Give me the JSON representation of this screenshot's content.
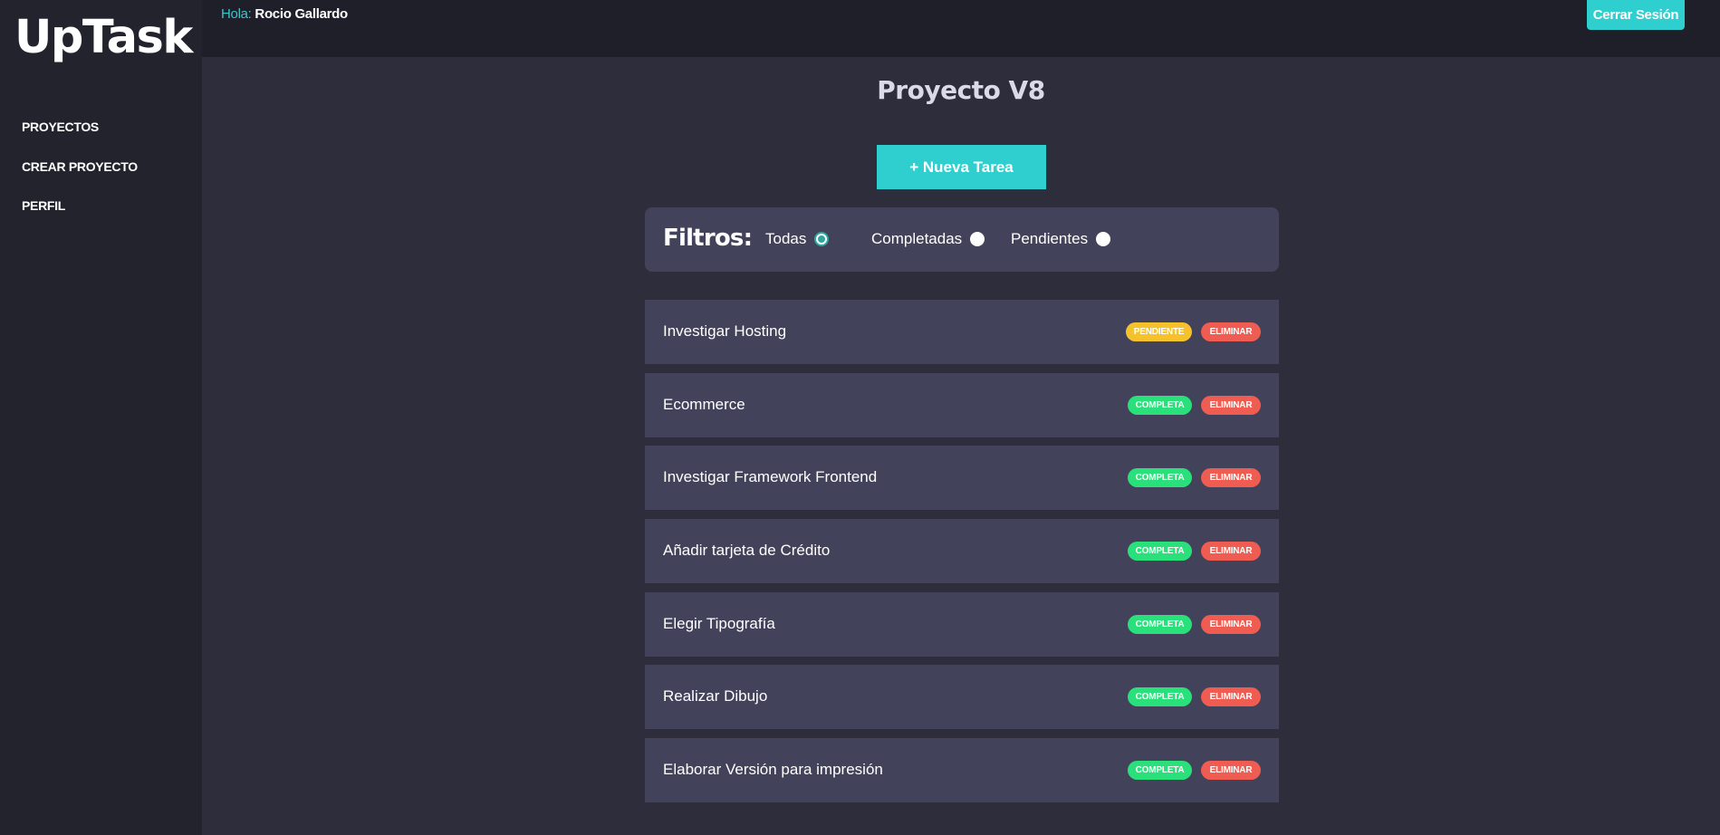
{
  "sidebar": {
    "logo": "UpTask",
    "nav": [
      "PROYECTOS",
      "CREAR PROYECTO",
      "PERFIL"
    ]
  },
  "header": {
    "greeting_label": "Hola:",
    "user_name": "Rocio Gallardo",
    "logout_label": "Cerrar Sesión"
  },
  "main": {
    "title": "Proyecto V8",
    "new_task_label": "+ Nueva Tarea",
    "filters": {
      "title": "Filtros:",
      "options": [
        {
          "label": "Todas",
          "checked": true
        },
        {
          "label": "Completadas",
          "checked": false
        },
        {
          "label": "Pendientes",
          "checked": false
        }
      ]
    },
    "tasks": [
      {
        "name": "Investigar Hosting",
        "status": "PENDIENTE",
        "delete_label": "ELIMINAR"
      },
      {
        "name": "Ecommerce",
        "status": "COMPLETA",
        "delete_label": "ELIMINAR"
      },
      {
        "name": "Investigar Framework Frontend",
        "status": "COMPLETA",
        "delete_label": "ELIMINAR"
      },
      {
        "name": "Añadir tarjeta de Crédito",
        "status": "COMPLETA",
        "delete_label": "ELIMINAR"
      },
      {
        "name": "Elegir Tipografía",
        "status": "COMPLETA",
        "delete_label": "ELIMINAR"
      },
      {
        "name": "Realizar Dibujo",
        "status": "COMPLETA",
        "delete_label": "ELIMINAR"
      },
      {
        "name": "Elaborar Versión para impresión",
        "status": "COMPLETA",
        "delete_label": "ELIMINAR"
      }
    ]
  },
  "colors": {
    "accent": "#2fcfcf",
    "pending": "#f5c22b",
    "complete": "#29e07a",
    "delete": "#ef5c52",
    "sidebar_bg": "#23232e",
    "main_bg": "#2d2d3b",
    "card_bg": "#42425a"
  }
}
